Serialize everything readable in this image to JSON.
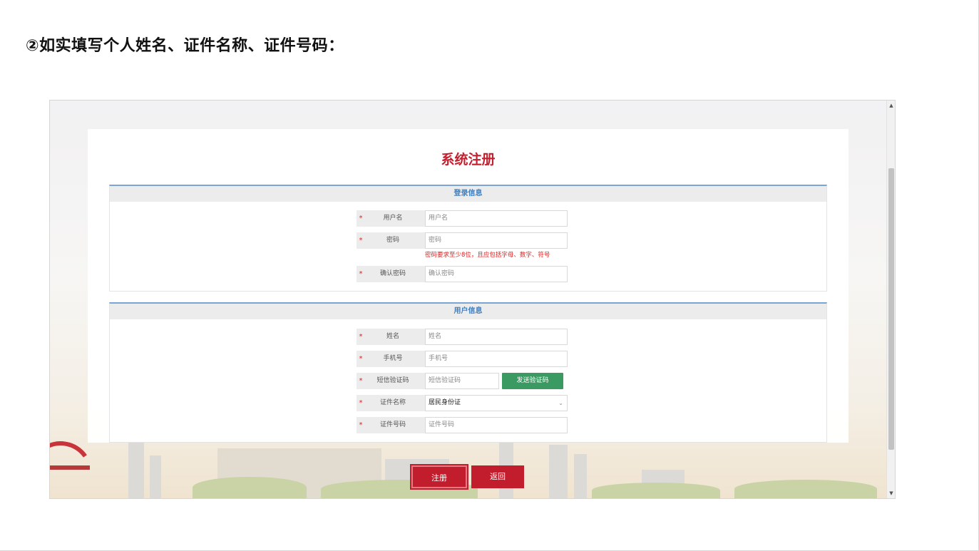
{
  "heading": "②如实填写个人姓名、证件名称、证件号码：",
  "page_title": "系统注册",
  "login_section": {
    "title": "登录信息",
    "fields": [
      {
        "label": "用户名",
        "placeholder": "用户名"
      },
      {
        "label": "密码",
        "placeholder": "密码"
      },
      {
        "label": "确认密码",
        "placeholder": "确认密码"
      }
    ],
    "password_hint": "密码要求至少8位，且应包括字母、数字、符号"
  },
  "user_section": {
    "title": "用户信息",
    "fields": [
      {
        "label": "姓名",
        "placeholder": "姓名"
      },
      {
        "label": "手机号",
        "placeholder": "手机号"
      },
      {
        "label": "短信验证码",
        "placeholder": "短信验证码"
      },
      {
        "label": "证件名称",
        "value": "居民身份证"
      },
      {
        "label": "证件号码",
        "placeholder": "证件号码"
      }
    ],
    "send_code_label": "发送验证码"
  },
  "required_mark": "*",
  "buttons": {
    "register": "注册",
    "back": "返回"
  },
  "icons": {
    "select": "chevron-down-icon",
    "scroll_up": "triangle-up-icon",
    "scroll_down": "triangle-down-icon"
  },
  "colors": {
    "accent": "#c21d2c",
    "section_border": "#7aa5d3",
    "section_title": "#3f7fc0",
    "sms_button": "#3a9a62",
    "required": "#dd2222"
  }
}
